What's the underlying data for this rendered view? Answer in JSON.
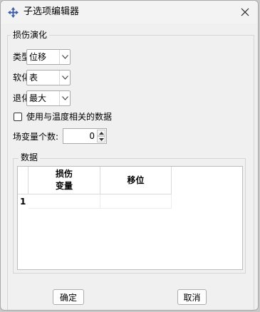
{
  "window": {
    "title": "子选项编辑器"
  },
  "damage_group": {
    "label": "损伤演化",
    "type": {
      "label": "类型:",
      "value": "位移"
    },
    "softening": {
      "label": "软化:",
      "value": "表"
    },
    "degradation": {
      "label": "退化:",
      "value": "最大"
    },
    "temp_checkbox": {
      "label": "使用与温度相关的数据",
      "checked": false
    },
    "field_vars": {
      "label": "场变量个数:",
      "value": "0"
    }
  },
  "data_group": {
    "label": "数据",
    "columns": [
      {
        "line1": "损伤",
        "line2": "变量"
      },
      {
        "line1": "移位",
        "line2": ""
      }
    ],
    "rows": [
      {
        "index": "1",
        "cells": [
          "",
          ""
        ]
      }
    ]
  },
  "buttons": {
    "ok": "确定",
    "cancel": "取消"
  }
}
